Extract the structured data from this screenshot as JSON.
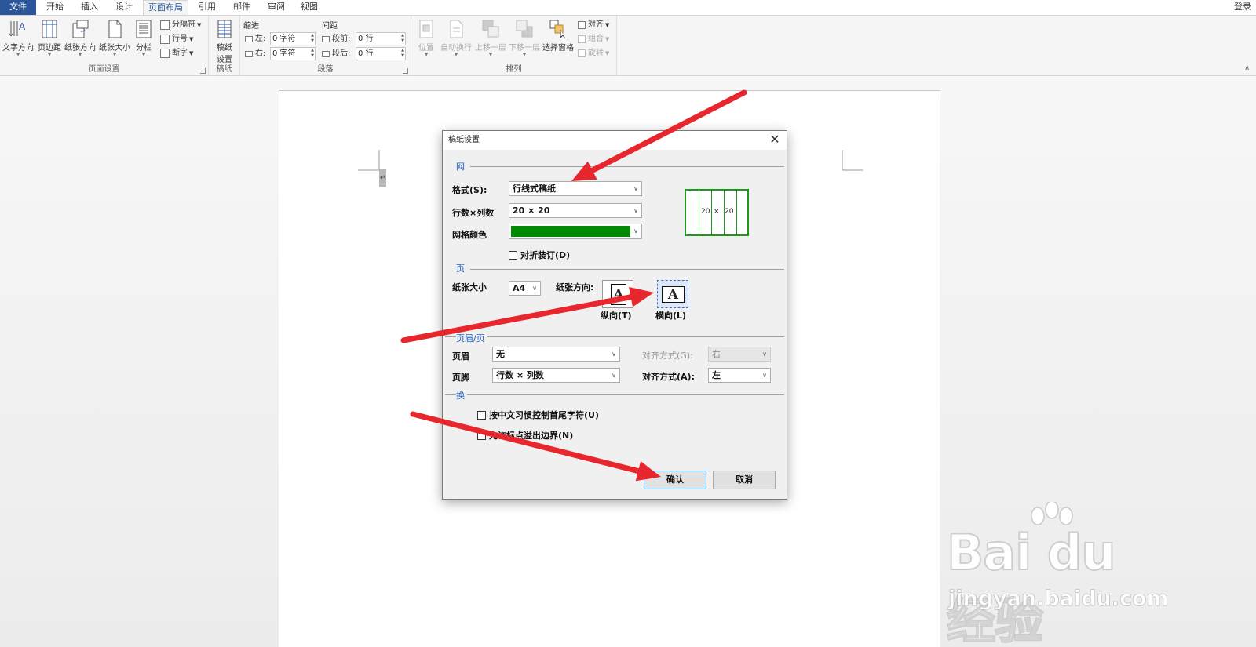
{
  "tabs": [
    {
      "label": "文件"
    },
    {
      "label": "开始"
    },
    {
      "label": "插入"
    },
    {
      "label": "设计"
    },
    {
      "label": "页面布局"
    },
    {
      "label": "引用"
    },
    {
      "label": "邮件"
    },
    {
      "label": "审阅"
    },
    {
      "label": "视图"
    }
  ],
  "login": "登录",
  "ribbon": {
    "page_setup": {
      "label": "页面设置",
      "text_direction": "文字方向",
      "margins": "页边距",
      "orientation": "纸张方向",
      "size": "纸张大小",
      "columns": "分栏",
      "breaks": "分隔符",
      "line_numbers": "行号",
      "hyphenation": "断字"
    },
    "manuscript": {
      "label": "稿纸",
      "button": "稿纸\n设置",
      "line1": "稿纸",
      "line2": "设置"
    },
    "paragraph": {
      "label": "段落",
      "indent": "缩进",
      "spacing": "间距",
      "left": "左:",
      "right": "右:",
      "before": "段前:",
      "after": "段后:",
      "left_value": "0 字符",
      "right_value": "0 字符",
      "before_value": "0 行",
      "after_value": "0 行"
    },
    "arrange": {
      "label": "排列",
      "position": "位置",
      "wrap": "自动换行",
      "forward": "上移一层",
      "backward": "下移一层",
      "selection_pane": "选择窗格",
      "align": "对齐",
      "group": "组合",
      "rotate": "旋转"
    }
  },
  "dialog": {
    "title": "稿纸设置",
    "section_grid": "网",
    "format_label": "格式(S):",
    "format_value": "行线式稿纸",
    "rows_cols_label": "行数×列数",
    "rows_cols_value": "20 × 20",
    "grid_color_label": "网格颜色",
    "grid_color": "#008a00",
    "fold_binding": "对折装订(D)",
    "preview_left": "20",
    "preview_x": "×",
    "preview_right": "20",
    "section_page": "页",
    "paper_size_label": "纸张大小",
    "paper_size_value": "A4",
    "orientation_label": "纸张方向:",
    "portrait": "纵向(T)",
    "landscape": "横向(L)",
    "orient_glyph": "A",
    "section_header": "页眉/页",
    "header_label": "页眉",
    "header_value": "无",
    "footer_label": "页脚",
    "footer_value": "行数 × 列数",
    "align_g_label": "对齐方式(G):",
    "align_g_value": "右",
    "align_a_label": "对齐方式(A):",
    "align_a_value": "左",
    "section_wrap": "换",
    "wrap_option1": "按中文习惯控制首尾字符(U)",
    "wrap_option2": "允许标点溢出边界(N)",
    "ok": "确认",
    "cancel": "取消"
  },
  "watermark": {
    "brand": "Bai du 经验",
    "url": "jingyan.baidu.com"
  },
  "colors": {
    "accent": "#2b579a",
    "annotation_arrow": "#e8262d",
    "grid_green": "#1d9a1d"
  }
}
